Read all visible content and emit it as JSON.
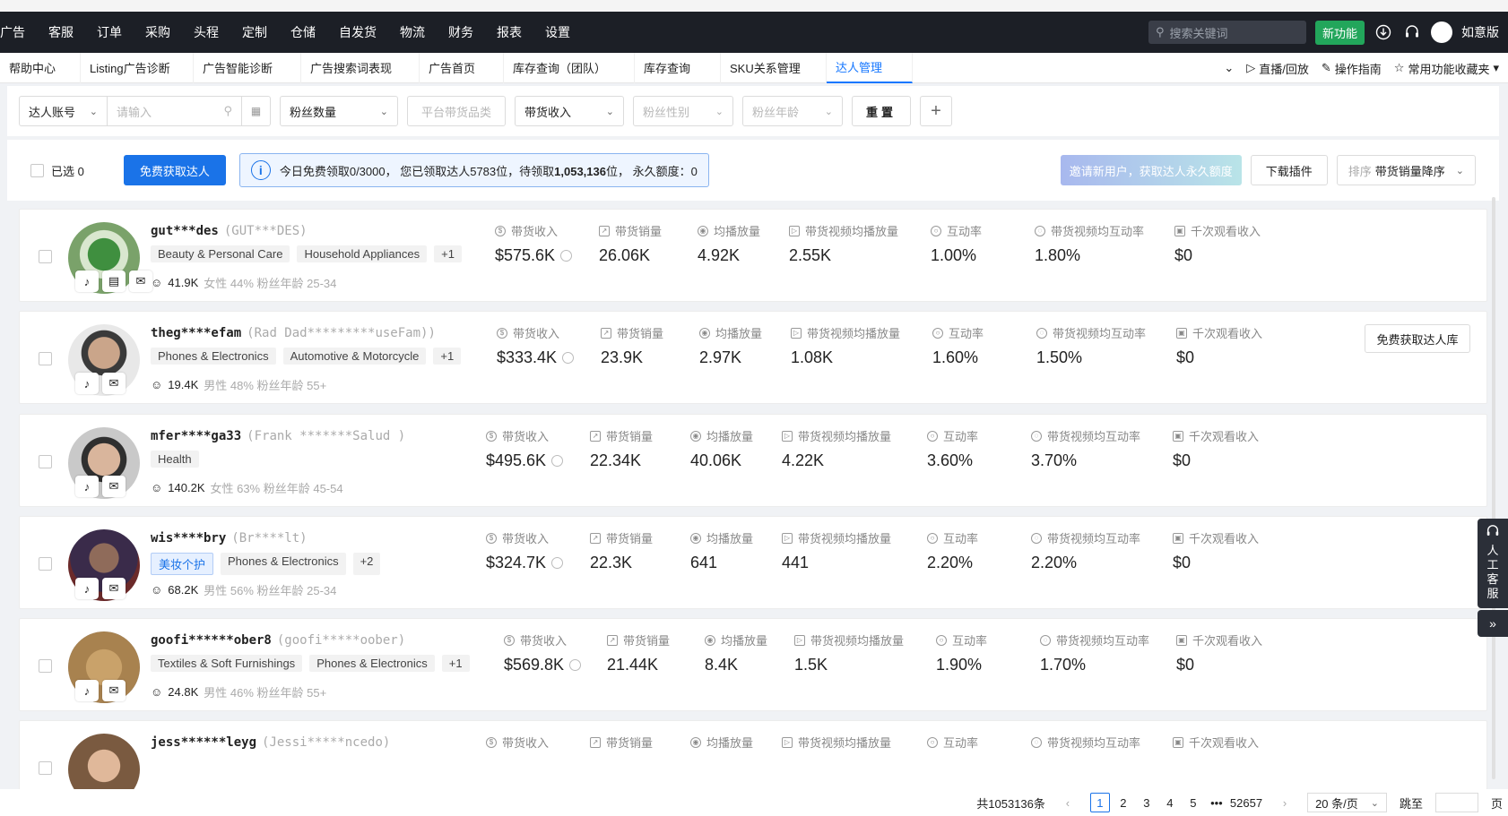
{
  "nav": {
    "items": [
      "广告",
      "客服",
      "订单",
      "采购",
      "头程",
      "定制",
      "仓储",
      "自发货",
      "物流",
      "财务",
      "报表",
      "设置"
    ],
    "search_placeholder": "搜索关键词",
    "new_feature": "新功能",
    "user": "如意版"
  },
  "subnav": {
    "tabs": [
      "帮助中心",
      "Listing广告诊断",
      "广告智能诊断",
      "广告搜索词表现",
      "广告首页",
      "库存查询（团队）",
      "库存查询",
      "SKU关系管理",
      "达人管理"
    ],
    "active_index": 8,
    "live": "直播/回放",
    "guide": "操作指南",
    "favorites": "常用功能收藏夹"
  },
  "filters": {
    "account_type": "达人账号",
    "input_placeholder": "请输入",
    "fans_count": "粉丝数量",
    "platform_category": "平台带货品类",
    "sales_income": "带货收入",
    "fans_gender": "粉丝性别",
    "fans_age": "粉丝年龄",
    "reset": "重置"
  },
  "toolbar": {
    "selected": "已选 0",
    "free_get": "免费获取达人",
    "info_prefix": "今日免费领取0/3000，  您已领取达人5783位，待领取",
    "info_bold": "1,053,136",
    "info_suffix": "位，  永久额度：0",
    "invite": "邀请新用户，获取达人永久额度",
    "download": "下载插件",
    "sort_label": "排序",
    "sort_value": "带货销量降序"
  },
  "metric_labels": {
    "income": "带货收入",
    "sales": "带货销量",
    "avg_play": "均播放量",
    "video_avg_play": "带货视频均播放量",
    "engagement": "互动率",
    "video_engagement": "带货视频均互动率",
    "cpm": "千次观看收入"
  },
  "get_button": "免费获取达人库",
  "creators": [
    {
      "handle": "gut***des",
      "alias": "(GUT***DES)",
      "tags": [
        {
          "t": "Beauty & Personal Care",
          "blue": false
        },
        {
          "t": "Household Appliances",
          "blue": false
        },
        {
          "t": "+1",
          "blue": false
        }
      ],
      "fans": "41.9K",
      "meta": "女性 44%  粉丝年龄 25-34",
      "income": "$575.6K",
      "sales": "26.06K",
      "avg_play": "4.92K",
      "video_avg_play": "2.55K",
      "engagement": "1.00%",
      "video_engagement": "1.80%",
      "cpm": "$0",
      "icons": [
        "tiktok-icon",
        "shop-icon",
        "link-icon"
      ]
    },
    {
      "handle": "theg****efam",
      "alias": "(Rad Dad*********useFam))",
      "tags": [
        {
          "t": "Phones & Electronics",
          "blue": false
        },
        {
          "t": "Automotive & Motorcycle",
          "blue": false
        },
        {
          "t": "+1",
          "blue": false
        }
      ],
      "fans": "19.4K",
      "meta": "男性 48%  粉丝年龄 55+",
      "income": "$333.4K",
      "sales": "23.9K",
      "avg_play": "2.97K",
      "video_avg_play": "1.08K",
      "engagement": "1.60%",
      "video_engagement": "1.50%",
      "cpm": "$0",
      "icons": [
        "tiktok-icon",
        "link-icon"
      ]
    },
    {
      "handle": "mfer****ga33",
      "alias": "(Frank *******Salud )",
      "tags": [
        {
          "t": "Health",
          "blue": false
        }
      ],
      "fans": "140.2K",
      "meta": "女性 63%  粉丝年龄 45-54",
      "income": "$495.6K",
      "sales": "22.34K",
      "avg_play": "40.06K",
      "video_avg_play": "4.22K",
      "engagement": "3.60%",
      "video_engagement": "3.70%",
      "cpm": "$0",
      "icons": [
        "tiktok-icon",
        "link-icon"
      ]
    },
    {
      "handle": "wis****bry",
      "alias": "(Br****lt)",
      "tags": [
        {
          "t": "美妆个护",
          "blue": true
        },
        {
          "t": "Phones & Electronics",
          "blue": false
        },
        {
          "t": "+2",
          "blue": false
        }
      ],
      "fans": "68.2K",
      "meta": "男性 56%  粉丝年龄 25-34",
      "income": "$324.7K",
      "sales": "22.3K",
      "avg_play": "641",
      "video_avg_play": "441",
      "engagement": "2.20%",
      "video_engagement": "2.20%",
      "cpm": "$0",
      "icons": [
        "tiktok-icon",
        "link-icon"
      ]
    },
    {
      "handle": "goofi******ober8",
      "alias": "(goofi*****oober)",
      "tags": [
        {
          "t": "Textiles & Soft Furnishings",
          "blue": false
        },
        {
          "t": "Phones & Electronics",
          "blue": false
        },
        {
          "t": "+1",
          "blue": false
        }
      ],
      "fans": "24.8K",
      "meta": "男性 46%  粉丝年龄 55+",
      "income": "$569.8K",
      "sales": "21.44K",
      "avg_play": "8.4K",
      "video_avg_play": "1.5K",
      "engagement": "1.90%",
      "video_engagement": "1.70%",
      "cpm": "$0",
      "icons": [
        "tiktok-icon",
        "link-icon"
      ]
    },
    {
      "handle": "jess******leyg",
      "alias": "(Jessi*****ncedo)",
      "tags": [],
      "fans": "",
      "meta": "",
      "income": "",
      "sales": "",
      "avg_play": "",
      "video_avg_play": "",
      "engagement": "",
      "video_engagement": "",
      "cpm": "",
      "icons": []
    }
  ],
  "pager": {
    "total": "共1053136条",
    "pages": [
      "1",
      "2",
      "3",
      "4",
      "5",
      "•••",
      "52657"
    ],
    "page_size": "20 条/页",
    "jump_label": "跳至",
    "page_unit": "页"
  },
  "float": {
    "customer_service": [
      "人",
      "工",
      "客",
      "服"
    ]
  }
}
